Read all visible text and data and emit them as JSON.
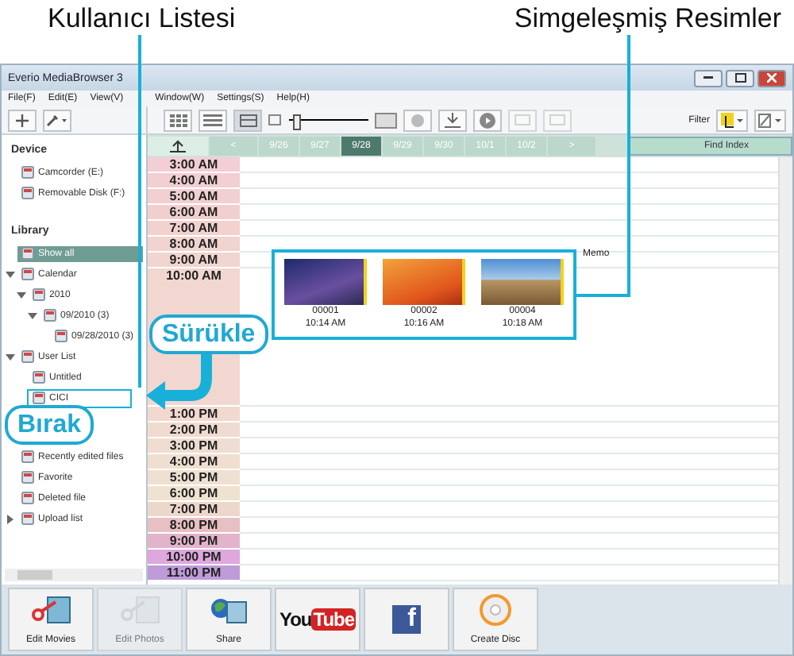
{
  "annotations": [
    {
      "text": "Kullanıcı Listesi"
    },
    {
      "text": "Simgeleşmiş Resimler"
    }
  ],
  "callouts": [
    {
      "text": "Sürükle"
    },
    {
      "text": "Bırak"
    }
  ],
  "window": {
    "title": "Everio MediaBrowser 3"
  },
  "menu": [
    "File(F)",
    "Edit(E)",
    "View(V)",
    "Window(W)",
    "Settings(S)",
    "Help(H)"
  ],
  "toolbar": {
    "zoom": {
      "level": 0.1
    },
    "filter": "Filter"
  },
  "sidebar": {
    "sections": [
      {
        "title": "Device",
        "items": [
          {
            "label": "Camcorder (E:)",
            "selected": false
          },
          {
            "label": "Removable Disk (F:)",
            "selected": false
          }
        ]
      },
      {
        "title": "Library",
        "items": [
          {
            "label": "Show all",
            "selected": true
          },
          {
            "label": "Calendar",
            "selected": false,
            "expanded": true,
            "children": [
              {
                "label": "2010",
                "selected": false,
                "expanded": true,
                "children": [
                  {
                    "label": "09/2010 (3)",
                    "selected": false,
                    "expanded": true,
                    "children": [
                      {
                        "label": "09/28/2010 (3)",
                        "selected": false
                      }
                    ]
                  }
                ]
              }
            ]
          },
          {
            "label": "User List",
            "selected": false,
            "expanded": true,
            "children": [
              {
                "label": "Untitled",
                "selected": false
              },
              {
                "label": "CICI",
                "selected": false,
                "drop_target": true
              }
            ]
          },
          {
            "label": "Recently edited files",
            "selected": false
          },
          {
            "label": "Favorite",
            "selected": false
          },
          {
            "label": "Deleted file",
            "selected": false
          },
          {
            "label": "Upload list",
            "selected": false,
            "expanded": false
          }
        ]
      }
    ]
  },
  "dates": [
    {
      "label": "<",
      "kind": "nav"
    },
    {
      "label": "9/26",
      "selected": false
    },
    {
      "label": "9/27",
      "selected": false
    },
    {
      "label": "9/28",
      "selected": true
    },
    {
      "label": "9/29",
      "selected": false
    },
    {
      "label": "9/30",
      "selected": false
    },
    {
      "label": "10/1",
      "selected": false
    },
    {
      "label": "10/2",
      "selected": false
    },
    {
      "label": ">",
      "kind": "nav"
    }
  ],
  "find_index": "Find Index",
  "times": [
    {
      "label": "3:00 AM"
    },
    {
      "label": "4:00 AM"
    },
    {
      "label": "5:00 AM"
    },
    {
      "label": "6:00 AM"
    },
    {
      "label": "7:00 AM"
    },
    {
      "label": "8:00 AM"
    },
    {
      "label": "9:00 AM"
    },
    {
      "label": "10:00 AM",
      "has_items": true
    },
    {
      "label": "1:00 PM"
    },
    {
      "label": "2:00 PM"
    },
    {
      "label": "3:00 PM"
    },
    {
      "label": "4:00 PM"
    },
    {
      "label": "5:00 PM"
    },
    {
      "label": "6:00 PM"
    },
    {
      "label": "7:00 PM"
    },
    {
      "label": "8:00 PM"
    },
    {
      "label": "9:00 PM"
    },
    {
      "label": "10:00 PM"
    },
    {
      "label": "11:00 PM"
    }
  ],
  "thumbnails": [
    {
      "name": "00001",
      "time": "10:14 AM",
      "kind": "night"
    },
    {
      "name": "00002",
      "time": "10:16 AM",
      "kind": "sunset"
    },
    {
      "name": "00004",
      "time": "10:18 AM",
      "kind": "sky"
    }
  ],
  "memo": "Memo",
  "actions": [
    {
      "label": "Edit Movies",
      "kind": "edit",
      "disabled": false
    },
    {
      "label": "Edit Photos",
      "kind": "edit",
      "disabled": true
    },
    {
      "label": "Share",
      "kind": "share",
      "disabled": false
    },
    {
      "kind": "youtube",
      "logo": [
        "You",
        "Tube"
      ],
      "disabled": false
    },
    {
      "kind": "facebook",
      "logo": [
        "f"
      ],
      "disabled": false
    },
    {
      "label": "Create Disc",
      "kind": "disc",
      "disabled": false
    }
  ]
}
